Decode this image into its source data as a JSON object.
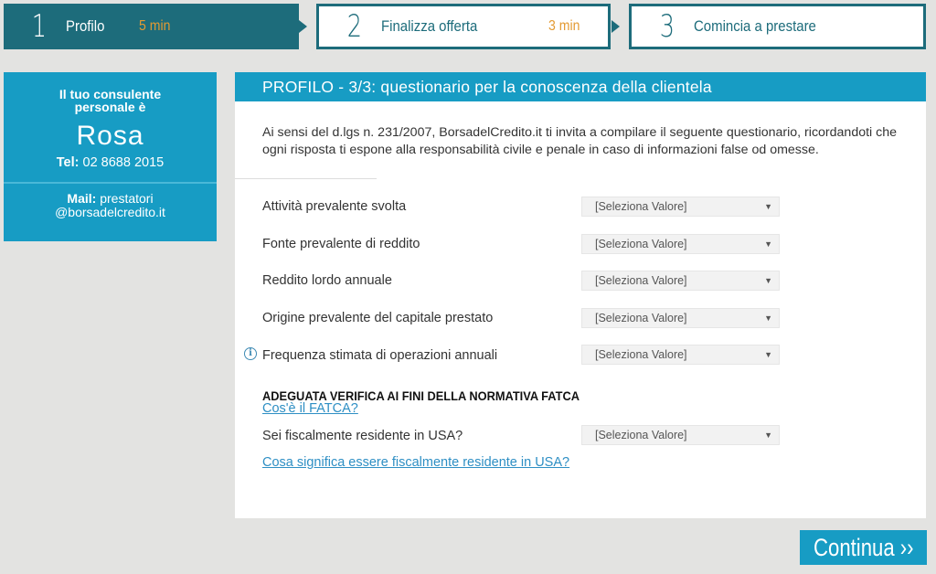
{
  "steps": [
    {
      "number": "1",
      "label": "Profilo",
      "time": "5 min"
    },
    {
      "number": "2",
      "label": "Finalizza offerta",
      "time": "3 min"
    },
    {
      "number": "3",
      "label": "Comincia a prestare"
    }
  ],
  "consultant": {
    "intro": "Il tuo consulente personale è",
    "name": "Rosa",
    "tel_label": "Tel:",
    "tel_value": "02 8688 2015",
    "mail_label": "Mail:",
    "mail_value_1": "prestatori",
    "mail_value_2": "@borsadelcredito.it"
  },
  "panel": {
    "title": "PROFILO - 3/3: questionario per la conoscenza della clientela",
    "intro": "Ai sensi del d.lgs n. 231/2007, BorsadelCredito.it ti invita a compilare il seguente questionario, ricordandoti che ogni risposta ti espone alla responsabilità civile e penale in caso di informazioni false od omesse.",
    "select_placeholder": "[Seleziona Valore]",
    "fields": [
      {
        "label": "Attività prevalente svolta",
        "value": "[Seleziona Valore]"
      },
      {
        "label": "Fonte prevalente di reddito",
        "value": "[Seleziona Valore]"
      },
      {
        "label": "Reddito lordo annuale",
        "value": "[Seleziona Valore]"
      },
      {
        "label": "Origine prevalente del capitale prestato",
        "value": "[Seleziona Valore]"
      },
      {
        "label": "Frequenza stimata di operazioni annuali",
        "value": "[Seleziona Valore]"
      }
    ],
    "fatca_title": "ADEGUATA VERIFICA AI FINI DELLA NORMATIVA FATCA",
    "fatca_link": "Cos'è il FATCA?",
    "usa_field": {
      "label": "Sei fiscalmente residente in USA?",
      "value": "[Seleziona Valore]"
    },
    "usa_link": "Cosa significa essere fiscalmente residente in USA?"
  },
  "continue_label": "Continua ››",
  "colors": {
    "accent": "#179cc4",
    "dark_teal": "#1d6c7b",
    "time_orange": "#e39a32",
    "link": "#2e8fc4"
  }
}
